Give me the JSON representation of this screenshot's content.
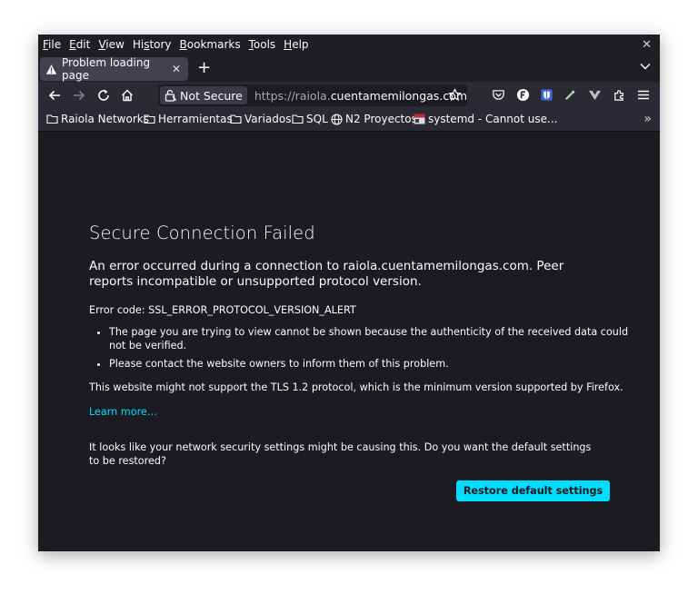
{
  "menubar": {
    "items": [
      {
        "underline": "F",
        "rest": "ile"
      },
      {
        "underline": "E",
        "rest": "dit"
      },
      {
        "underline": "V",
        "rest": "iew"
      },
      {
        "pre": "Hi",
        "underline": "s",
        "rest": "tory"
      },
      {
        "underline": "B",
        "rest": "ookmarks"
      },
      {
        "underline": "T",
        "rest": "ools"
      },
      {
        "underline": "H",
        "rest": "elp"
      }
    ],
    "close_icon": "close-icon"
  },
  "tab": {
    "title": "Problem loading page",
    "icon": "warning-icon"
  },
  "urlbar": {
    "security_label": "Not Secure",
    "url_prefix": "https://raiola.",
    "url_host": "cuentamemilongas.com"
  },
  "bookmarks": [
    {
      "label": "Raiola Networks",
      "icon": "folder-icon"
    },
    {
      "label": "Herramientas",
      "icon": "folder-icon"
    },
    {
      "label": "Variados",
      "icon": "folder-icon"
    },
    {
      "label": "SQL",
      "icon": "folder-icon"
    },
    {
      "label": "N2 Proyectos",
      "icon": "globe-icon"
    },
    {
      "label": "systemd - Cannot use...",
      "icon": "site-favicon"
    }
  ],
  "error": {
    "title": "Secure Connection Failed",
    "short_desc": "An error occurred during a connection to raiola.cuentamemilongas.com. Peer reports incompatible or unsupported protocol version.",
    "code_line": "Error code: SSL_ERROR_PROTOCOL_VERSION_ALERT",
    "bullets": [
      "The page you are trying to view cannot be shown because the authenticity of the received data could not be verified.",
      "Please contact the website owners to inform them of this problem."
    ],
    "tls_note": "This website might not support the TLS 1.2 protocol, which is the minimum version supported by Firefox.",
    "learn_more": "Learn more…",
    "prefs_note": "It looks like your network security settings might be causing this. Do you want the default settings to be restored?",
    "restore_button": "Restore default settings"
  },
  "colors": {
    "accent": "#00ddff",
    "page_bg": "#1c1b22",
    "toolbar_bg": "#2b2a33"
  }
}
